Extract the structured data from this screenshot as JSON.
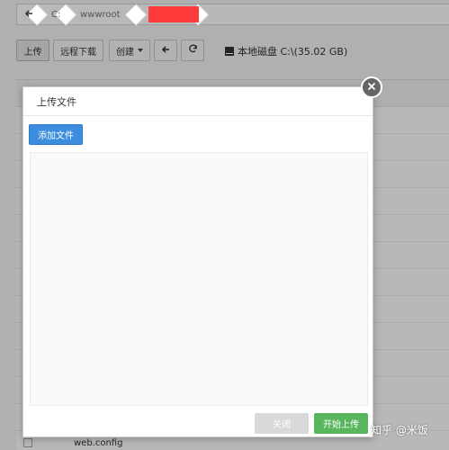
{
  "breadcrumb": {
    "drive": "C:",
    "folder": "wwwroot",
    "redacted_color": "#ff3b3b"
  },
  "toolbar": {
    "upload_label": "上传",
    "remote_download_label": "远程下载",
    "create_label": "创建",
    "disk_label": "本地磁盘 C:\\(35.02 GB)"
  },
  "file_list": {
    "last_file_name": "web.config"
  },
  "modal": {
    "title": "上传文件",
    "add_files_label": "添加文件",
    "close_label": "关闭",
    "start_upload_label": "开始上传"
  },
  "colors": {
    "primary": "#3c8dde",
    "success": "#58b65c",
    "disabled": "#d9d9d9"
  },
  "icons": {
    "back": "arrow-left-icon",
    "refresh": "refresh-icon",
    "disk": "hard-drive-icon",
    "close": "close-icon"
  },
  "watermark": "知乎 @米饭"
}
